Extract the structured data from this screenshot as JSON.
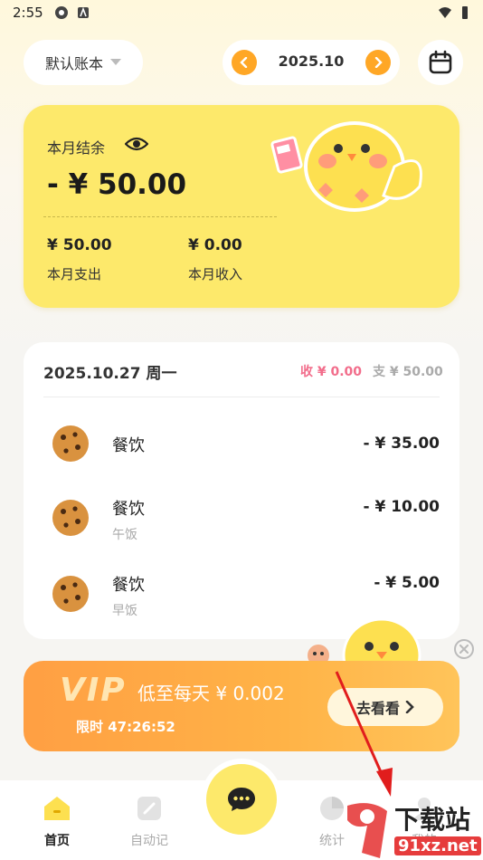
{
  "status_bar": {
    "time": "2:55"
  },
  "header": {
    "ledger_name": "默认账本",
    "month": "2025.10"
  },
  "summary": {
    "balance_label": "本月结余",
    "balance_amount": "- ¥ 50.00",
    "expense_value": "¥ 50.00",
    "expense_label": "本月支出",
    "income_value": "¥ 0.00",
    "income_label": "本月收入"
  },
  "day_group": {
    "date": "2025.10.27 周一",
    "income": "收 ¥ 0.00",
    "expense": "支 ¥ 50.00",
    "transactions": [
      {
        "category": "餐饮",
        "note": "",
        "amount": "- ¥ 35.00"
      },
      {
        "category": "餐饮",
        "note": "午饭",
        "amount": "- ¥ 10.00"
      },
      {
        "category": "餐饮",
        "note": "早饭",
        "amount": "- ¥ 5.00"
      }
    ]
  },
  "vip_banner": {
    "logo": "VIP",
    "price_text": "低至每天 ¥ 0.002",
    "timer": "限时 47:26:52",
    "button_label": "去看看"
  },
  "tabs": [
    {
      "label": "首页",
      "icon": "home-icon",
      "active": true
    },
    {
      "label": "自动记",
      "icon": "auto-record-icon",
      "active": false
    },
    {
      "label": "统计",
      "icon": "stats-icon",
      "active": false
    },
    {
      "label": "我的",
      "icon": "profile-icon",
      "active": false
    }
  ],
  "center_action": {
    "icon": "chat-icon"
  },
  "watermark": {
    "text": "下载站",
    "url_text": "91xz.net"
  },
  "colors": {
    "accent_yellow": "#fde96b",
    "accent_orange": "#ffa726",
    "income_pink": "#f26d8b",
    "vip_orange": "#ff9f43"
  }
}
